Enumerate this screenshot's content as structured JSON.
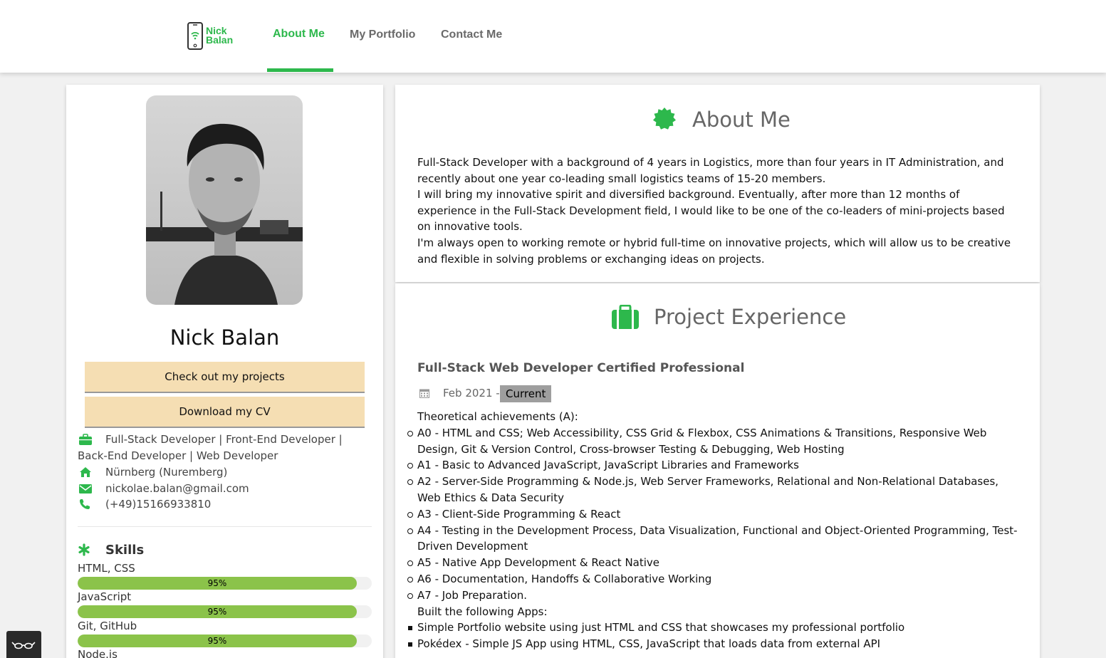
{
  "brand": {
    "line1": "Nick",
    "line2": "Balan"
  },
  "nav": [
    {
      "label": "About Me",
      "active": true
    },
    {
      "label": "My Portfolio",
      "active": false
    },
    {
      "label": "Contact Me",
      "active": false
    }
  ],
  "accent": "#2db84c",
  "profile": {
    "name": "Nick Balan",
    "buttons": {
      "projects": "Check out my projects",
      "cv": "Download my CV"
    },
    "roles": "Full-Stack Developer | Front-End Developer | Back-End Developer | Web Developer",
    "location": "Nürnberg (Nuremberg)",
    "email": "nickolae.balan@gmail.com",
    "phone": "(+49)15166933810"
  },
  "skills": {
    "title": "Skills",
    "items": [
      {
        "name": "HTML, CSS",
        "level": "95%"
      },
      {
        "name": "JavaScript",
        "level": "95%"
      },
      {
        "name": "Git, GitHub",
        "level": "95%"
      },
      {
        "name": "Node.js",
        "level": ""
      }
    ]
  },
  "about": {
    "title": "About Me",
    "paragraphs": [
      "Full-Stack Developer with a background of 4 years in Logistics, more than four years in IT Administration, and recently about one year co-leading small logistics teams of 15-20 members.",
      "I will bring my innovative spirit and diversified background. Eventually, after more than 12 months of experience in the Full-Stack Development field, I would like to be one of the co-leaders of mini-projects based on innovative tools.",
      "I'm always open to working remote or hybrid full-time on innovative projects, which will allow us to be creative and flexible in solving problems or exchanging ideas on projects."
    ]
  },
  "experience": {
    "title": "Project Experience",
    "job_title": "Full-Stack Web Developer Certified Professional",
    "date": "Feb 2021 -",
    "badge": "Current",
    "theory_heading": "Theoretical achievements (A):",
    "theory": [
      "A0 - HTML and CSS; Web Accessibility, CSS Grid & Flexbox, CSS Animations & Transitions, Responsive Web Design, Git & Version Control, Cross-browser Testing & Debugging, Web Hosting",
      "A1 - Basic to Advanced JavaScript, JavaScript Libraries and Frameworks",
      "A2 - Server-Side Programming & Node.js, Web Server Frameworks, Relational and Non-Relational Databases, Web Ethics & Data Security",
      "A3 - Client-Side Programming & React",
      "A4 - Testing in the Development Process, Data Visualization, Functional and Object-Oriented Programming, Test-Driven Development",
      "A5 - Native App Development & React Native",
      "A6 - Documentation, Handoffs & Collaborative Working",
      "A7 - Job Preparation."
    ],
    "apps_heading": "Built the following Apps:",
    "apps": [
      "Simple Portfolio website using just HTML and CSS that showcases my professional portfolio",
      "Pokédex - Simple JS App using HTML, CSS, JavaScript that loads data from external API"
    ]
  }
}
